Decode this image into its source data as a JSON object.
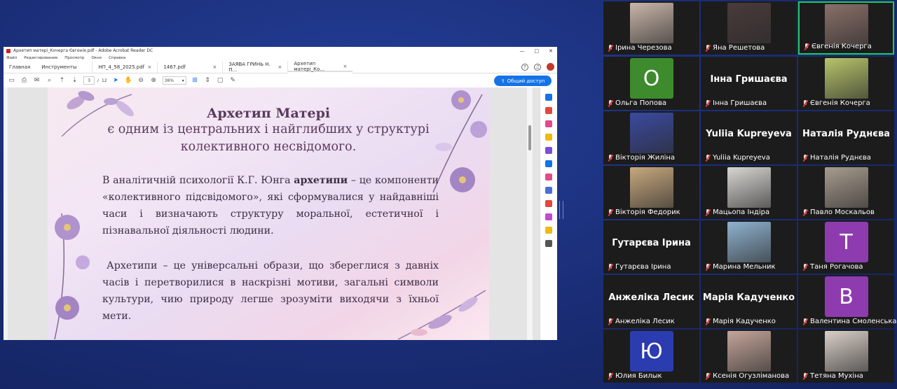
{
  "window": {
    "title": "Архетип матері_Кочерга Євгенія.pdf - Adobe Acrobat Reader DC",
    "controls": [
      "—",
      "□",
      "✕"
    ]
  },
  "menu": [
    "Файл",
    "Редактирование",
    "Просмотр",
    "Окно",
    "Справка"
  ],
  "tabs": {
    "home": "Главная",
    "tools": "Инструменты",
    "docs": [
      "НП_4_58_2025.pdf",
      "1467.pdf",
      "ЗАЯВА ГРИНЬ Н. П...",
      "Архетип матері_Ко..."
    ]
  },
  "toolbar": {
    "page_current": "3",
    "page_sep": "/",
    "page_total": "12",
    "zoom": "36%",
    "share_label": "Общий доступ"
  },
  "slide": {
    "title": "Архетип Матері",
    "subtitle_1": "є одним із центральних і найглибших у структурі",
    "subtitle_2": "колективного несвідомого.",
    "para1_a": "В аналітичній психології К.Г. Юнга ",
    "para1_bold": "архетипи",
    "para1_b": " – це компоненти «колективного підсвідомого», які сформувалися у найдавніші часи і визначають структуру моральної, естетичної і пізнавальної діяльності людини.",
    "para2": "Архетипи – це універсальні образи, що збереглися з давніх часів і перетворилися в наскрізні мотиви, загальні символи культури, чию природу легше зрозуміти виходячи з їхньої мети."
  },
  "participants": [
    {
      "name": "Ірина Черезова",
      "kind": "photo",
      "color": "#c9b6a8"
    },
    {
      "name": "Яна Решетова",
      "kind": "photo",
      "color": "#4a3b3a"
    },
    {
      "name": "Євгенія Кочерга",
      "kind": "photo",
      "color": "#8a7068",
      "active": true
    },
    {
      "name": "Ольга Попова",
      "kind": "letter",
      "letter": "О",
      "color": "#3d8b2c"
    },
    {
      "name": "Інна Гришаєва",
      "kind": "text",
      "big": "Інна Гришаєва"
    },
    {
      "name": "Євгенія Кочерга",
      "kind": "photo",
      "color": "#b7c46a"
    },
    {
      "name": "Вікторія Жиліна",
      "kind": "photo",
      "color": "#3a4aa0"
    },
    {
      "name": "Yuliia Kupreyeva",
      "kind": "text",
      "big": "Yuliia Kupreyeva"
    },
    {
      "name": "Наталія Руднєва",
      "kind": "text",
      "big": "Наталія Руднєва"
    },
    {
      "name": "Вікторія Федорик",
      "kind": "photo",
      "color": "#c7a87e"
    },
    {
      "name": "Мацьопа Індіра",
      "kind": "photo",
      "color": "#d8d6d2"
    },
    {
      "name": "Павло Москальов",
      "kind": "photo",
      "color": "#a89c8e"
    },
    {
      "name": "Гутарєва Ірина",
      "kind": "text",
      "big": "Гутарєва Ірина"
    },
    {
      "name": "Марина Мельник",
      "kind": "photo",
      "color": "#8fb2cf"
    },
    {
      "name": "Таня Рогачова",
      "kind": "letter",
      "letter": "Т",
      "color": "#8e3bb0"
    },
    {
      "name": "Анжеліка Лесик",
      "kind": "text",
      "big": "Анжеліка Лесик"
    },
    {
      "name": "Марія Кадученко",
      "kind": "text",
      "big": "Марія Кадученко"
    },
    {
      "name": "Валентина Смоленська",
      "kind": "letter",
      "letter": "В",
      "color": "#8e3bb0"
    },
    {
      "name": "Юлия Билык",
      "kind": "letter",
      "letter": "Ю",
      "color": "#2b3cb0"
    },
    {
      "name": "Ксенія Огузліманова",
      "kind": "photo",
      "color": "#c4a59a"
    },
    {
      "name": "Тетяна Мухіна",
      "kind": "photo",
      "color": "#d9cfc8"
    }
  ]
}
